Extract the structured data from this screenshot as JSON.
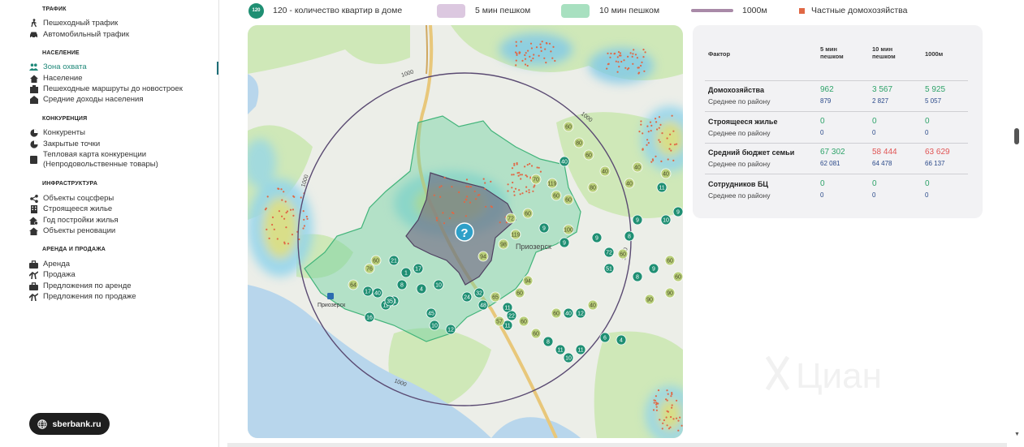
{
  "sidebar": {
    "sections": [
      {
        "title": "ТРАФИК",
        "items": [
          {
            "label": "Пешеходный трафик",
            "icon": "walking-person-icon"
          },
          {
            "label": "Автомобильный трафик",
            "icon": "car-icon"
          }
        ]
      },
      {
        "title": "НАСЕЛЕНИЕ",
        "items": [
          {
            "label": "Зона охвата",
            "icon": "people-icon",
            "active": true
          },
          {
            "label": "Население",
            "icon": "house-icon"
          },
          {
            "label": "Пешеходные маршруты до новостроек",
            "icon": "route-icon"
          },
          {
            "label": "Средние доходы населения",
            "icon": "wallet-icon"
          }
        ]
      },
      {
        "title": "КОНКУРЕНЦИЯ",
        "items": [
          {
            "label": "Конкуренты",
            "icon": "pie-icon"
          },
          {
            "label": "Закрытые точки",
            "icon": "pie-icon"
          },
          {
            "label": "Тепловая карта конкуренции (Непродовольственные товары)",
            "icon": "doc-icon"
          }
        ]
      },
      {
        "title": "ИНФРАСТРУКТУРА",
        "items": [
          {
            "label": "Объекты соцсферы",
            "icon": "share-icon"
          },
          {
            "label": "Строящееся жилье",
            "icon": "building-icon"
          },
          {
            "label": "Год постройки жилья",
            "icon": "house-gear-icon"
          },
          {
            "label": "Объекты реновации",
            "icon": "house-icon"
          }
        ]
      },
      {
        "title": "АРЕНДА И ПРОДАЖА",
        "items": [
          {
            "label": "Аренда",
            "icon": "briefcase-icon"
          },
          {
            "label": "Продажа",
            "icon": "handshake-icon"
          },
          {
            "label": "Предложения по аренде",
            "icon": "briefcase-icon"
          },
          {
            "label": "Предложения по продаже",
            "icon": "handshake-icon"
          }
        ]
      }
    ],
    "site_button": "sberbank.ru"
  },
  "legend": {
    "dot_label": "120",
    "apartments": "120 - количество квартир в доме",
    "walk5": "5 мин пешком",
    "walk10": "10 мин пешком",
    "dist1000": "1000м",
    "private": "Частные домохозяйства"
  },
  "map": {
    "ring_label": "1000",
    "place_label": "Приозерск",
    "station_label": "Приозерск",
    "center_icon": "?",
    "watermark": "Циан",
    "colors": {
      "walk10": "#6fd0a0",
      "walk5": "#7a6a8a",
      "ring": "#5a4a72",
      "house": "#1f8f73",
      "light_house": "#b9cf7a"
    }
  },
  "table": {
    "headers": {
      "factor": "Фактор",
      "c5": "5 мин пешком",
      "c10": "10 мин пешком",
      "c1000": "1000м"
    },
    "rows": [
      {
        "label": "Домохозяйства",
        "sub": "Среднее по району",
        "v5": "962",
        "v10": "3 567",
        "v1000": "5 925",
        "s5": "879",
        "s10": "2 827",
        "s1000": "5 057",
        "colors": [
          "g",
          "g",
          "g"
        ]
      },
      {
        "label": "Строящееся жилье",
        "sub": "Среднее по району",
        "v5": "0",
        "v10": "0",
        "v1000": "0",
        "s5": "0",
        "s10": "0",
        "s1000": "0",
        "colors": [
          "g",
          "g",
          "g"
        ]
      },
      {
        "label": "Средний бюджет семьи",
        "sub": "Среднее по району",
        "v5": "67 302",
        "v10": "58 444",
        "v1000": "63 629",
        "s5": "62 081",
        "s10": "64 478",
        "s1000": "66 137",
        "colors": [
          "g",
          "r",
          "r"
        ]
      },
      {
        "label": "Сотрудников БЦ",
        "sub": "Среднее по району",
        "v5": "0",
        "v10": "0",
        "v1000": "0",
        "s5": "0",
        "s10": "0",
        "s1000": "0",
        "colors": [
          "g",
          "g",
          "g"
        ]
      }
    ]
  }
}
